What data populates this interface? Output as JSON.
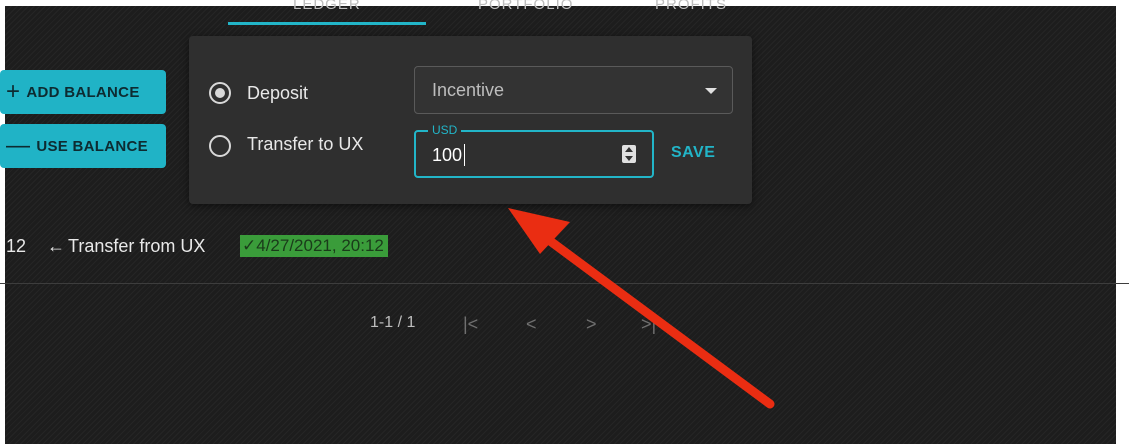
{
  "tabs": [
    {
      "label": "Ledger"
    },
    {
      "label": "Portfolio"
    },
    {
      "label": "Profits"
    }
  ],
  "actions": {
    "add_balance": {
      "symbol": "+",
      "label": "ADD BALANCE"
    },
    "use_balance": {
      "symbol": "—",
      "label": "USE BALANCE"
    }
  },
  "form": {
    "options": [
      {
        "label": "Deposit",
        "selected": true
      },
      {
        "label": "Transfer to UX",
        "selected": false
      }
    ],
    "type_select": {
      "value": "Incentive"
    },
    "amount": {
      "label": "USD",
      "value": "100"
    },
    "save_label": "SAVE"
  },
  "ledger_row": {
    "leading": "12",
    "arrow": "←",
    "description": "Transfer from UX",
    "status_check": "✓",
    "timestamp": "4/27/2021, 20:12"
  },
  "pagination": {
    "range": "1-1 / 1",
    "first": "|<",
    "prev": "<",
    "next": ">",
    "last": ">|"
  },
  "annotation": {
    "color": "#ea2d12"
  }
}
